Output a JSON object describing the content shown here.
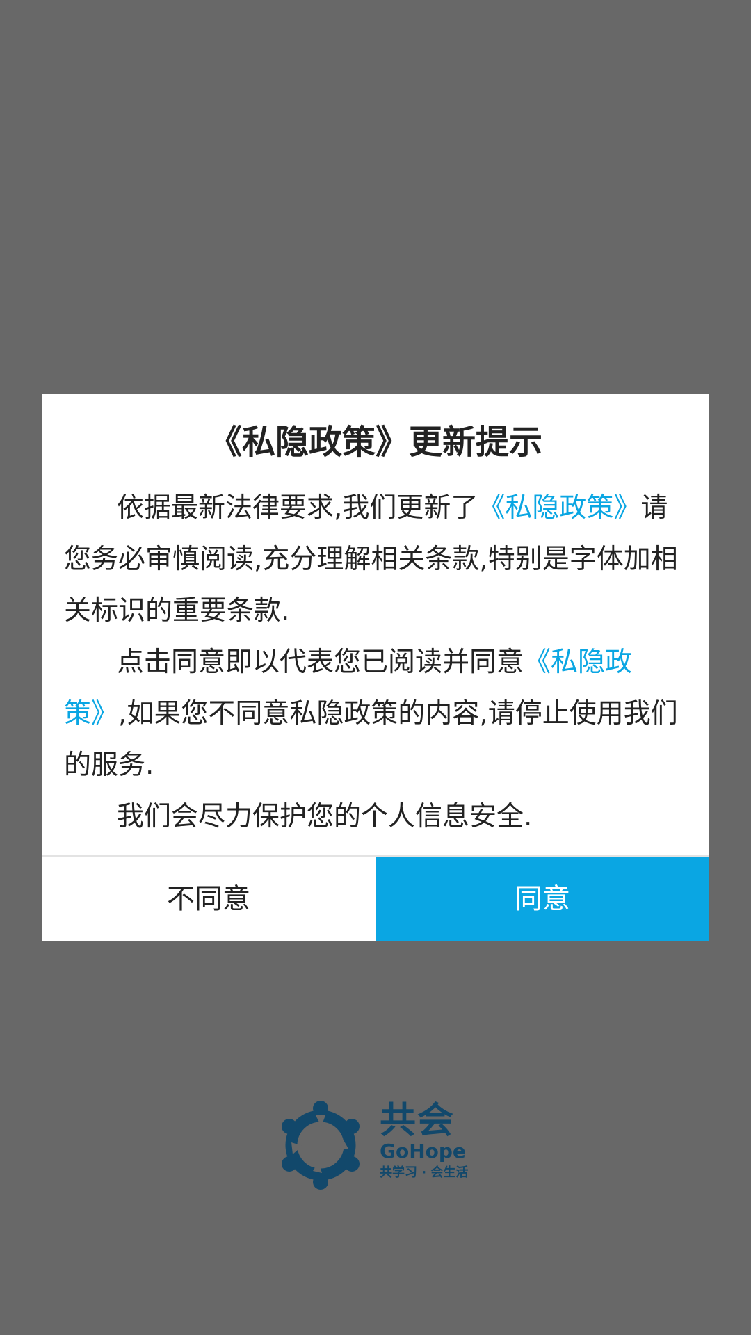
{
  "dialog": {
    "title": "《私隐政策》更新提示",
    "paragraphs": [
      {
        "before": "依据最新法律要求,我们更新了",
        "link": "《私隐政策》",
        "after": "请您务必审慎阅读,充分理解相关条款,特别是字体加相关标识的重要条款."
      },
      {
        "before": "点击同意即以代表您已阅读并同意",
        "link": "《私隐政策》",
        "after": ",如果您不同意私隐政策的内容,请停止使用我们的服务."
      },
      {
        "before": "我们会尽力保护您的个人信息安全."
      }
    ],
    "buttons": {
      "disagree": "不同意",
      "agree": "同意"
    }
  },
  "brand": {
    "name_cn": "共会",
    "name_en": "GoHope",
    "slogan": "共学习 · 会生活"
  },
  "colors": {
    "overlay": "#686868",
    "accent": "#0aa6e3",
    "brand": "#12486b"
  }
}
